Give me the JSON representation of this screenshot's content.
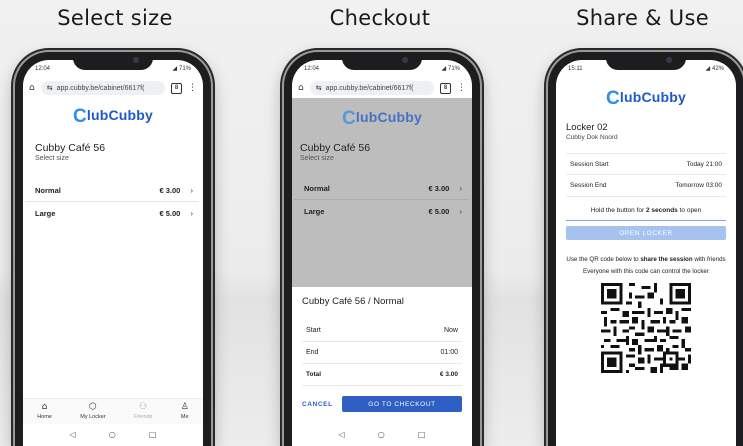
{
  "captions": [
    "Select size",
    "Checkout",
    "Share & Use"
  ],
  "phone1": {
    "status_time": "12:04",
    "status_batt": "71%",
    "url": "app.cubby.be/cabinet/6617f(",
    "tab_count": "8",
    "logo_text": "lubCubby",
    "logo_c": "C",
    "shop_title": "Cubby Café 56",
    "shop_sub": "Select size",
    "sizes": [
      {
        "name": "Normal",
        "price": "€ 3.00"
      },
      {
        "name": "Large",
        "price": "€ 5.00"
      }
    ],
    "nav": [
      {
        "label": "Home",
        "icon": "home-icon"
      },
      {
        "label": "My Locker",
        "icon": "locker-icon"
      },
      {
        "label": "Friends",
        "icon": "friends-icon"
      },
      {
        "label": "Me",
        "icon": "user-icon"
      }
    ]
  },
  "phone2": {
    "status_time": "12:04",
    "status_batt": "71%",
    "url": "app.cubby.be/cabinet/6617f(",
    "tab_count": "8",
    "logo_text": "lubCubby",
    "logo_c": "C",
    "shop_title": "Cubby Café 56",
    "shop_sub": "Select size",
    "sizes": [
      {
        "name": "Normal",
        "price": "€ 3.00"
      },
      {
        "name": "Large",
        "price": "€ 5.00"
      }
    ],
    "sheet_title": "Cubby Café 56 / Normal",
    "rows": [
      {
        "label": "Start",
        "value": "Now"
      },
      {
        "label": "End",
        "value": "01:00"
      },
      {
        "label": "Total",
        "value": "€ 3.00"
      }
    ],
    "cancel_label": "CANCEL",
    "checkout_label": "GO TO CHECKOUT"
  },
  "phone3": {
    "status_time": "15:11",
    "status_batt": "42%",
    "logo_text": "lubCubby",
    "logo_c": "C",
    "locker_title": "Locker 02",
    "locker_sub": "Cubby Dok Noord",
    "session_rows": [
      {
        "label": "Session Start",
        "value": "Today 21:00"
      },
      {
        "label": "Session End",
        "value": "Tomorrow 03:00"
      }
    ],
    "hold_prefix": "Hold the button for ",
    "hold_bold": "2 seconds",
    "hold_suffix": " to open",
    "open_label": "OPEN LOCKER",
    "qr_prefix": "Use the QR code below to ",
    "qr_bold": "share the session",
    "qr_suffix": " with friends",
    "qr_note": "Everyone with this code can control the locker"
  },
  "colors": {
    "brand_blue": "#1f58c8",
    "primary_button": "#2f5ec4",
    "disabled_button": "#a5c3ee",
    "overlay": "#bdbdbd"
  }
}
